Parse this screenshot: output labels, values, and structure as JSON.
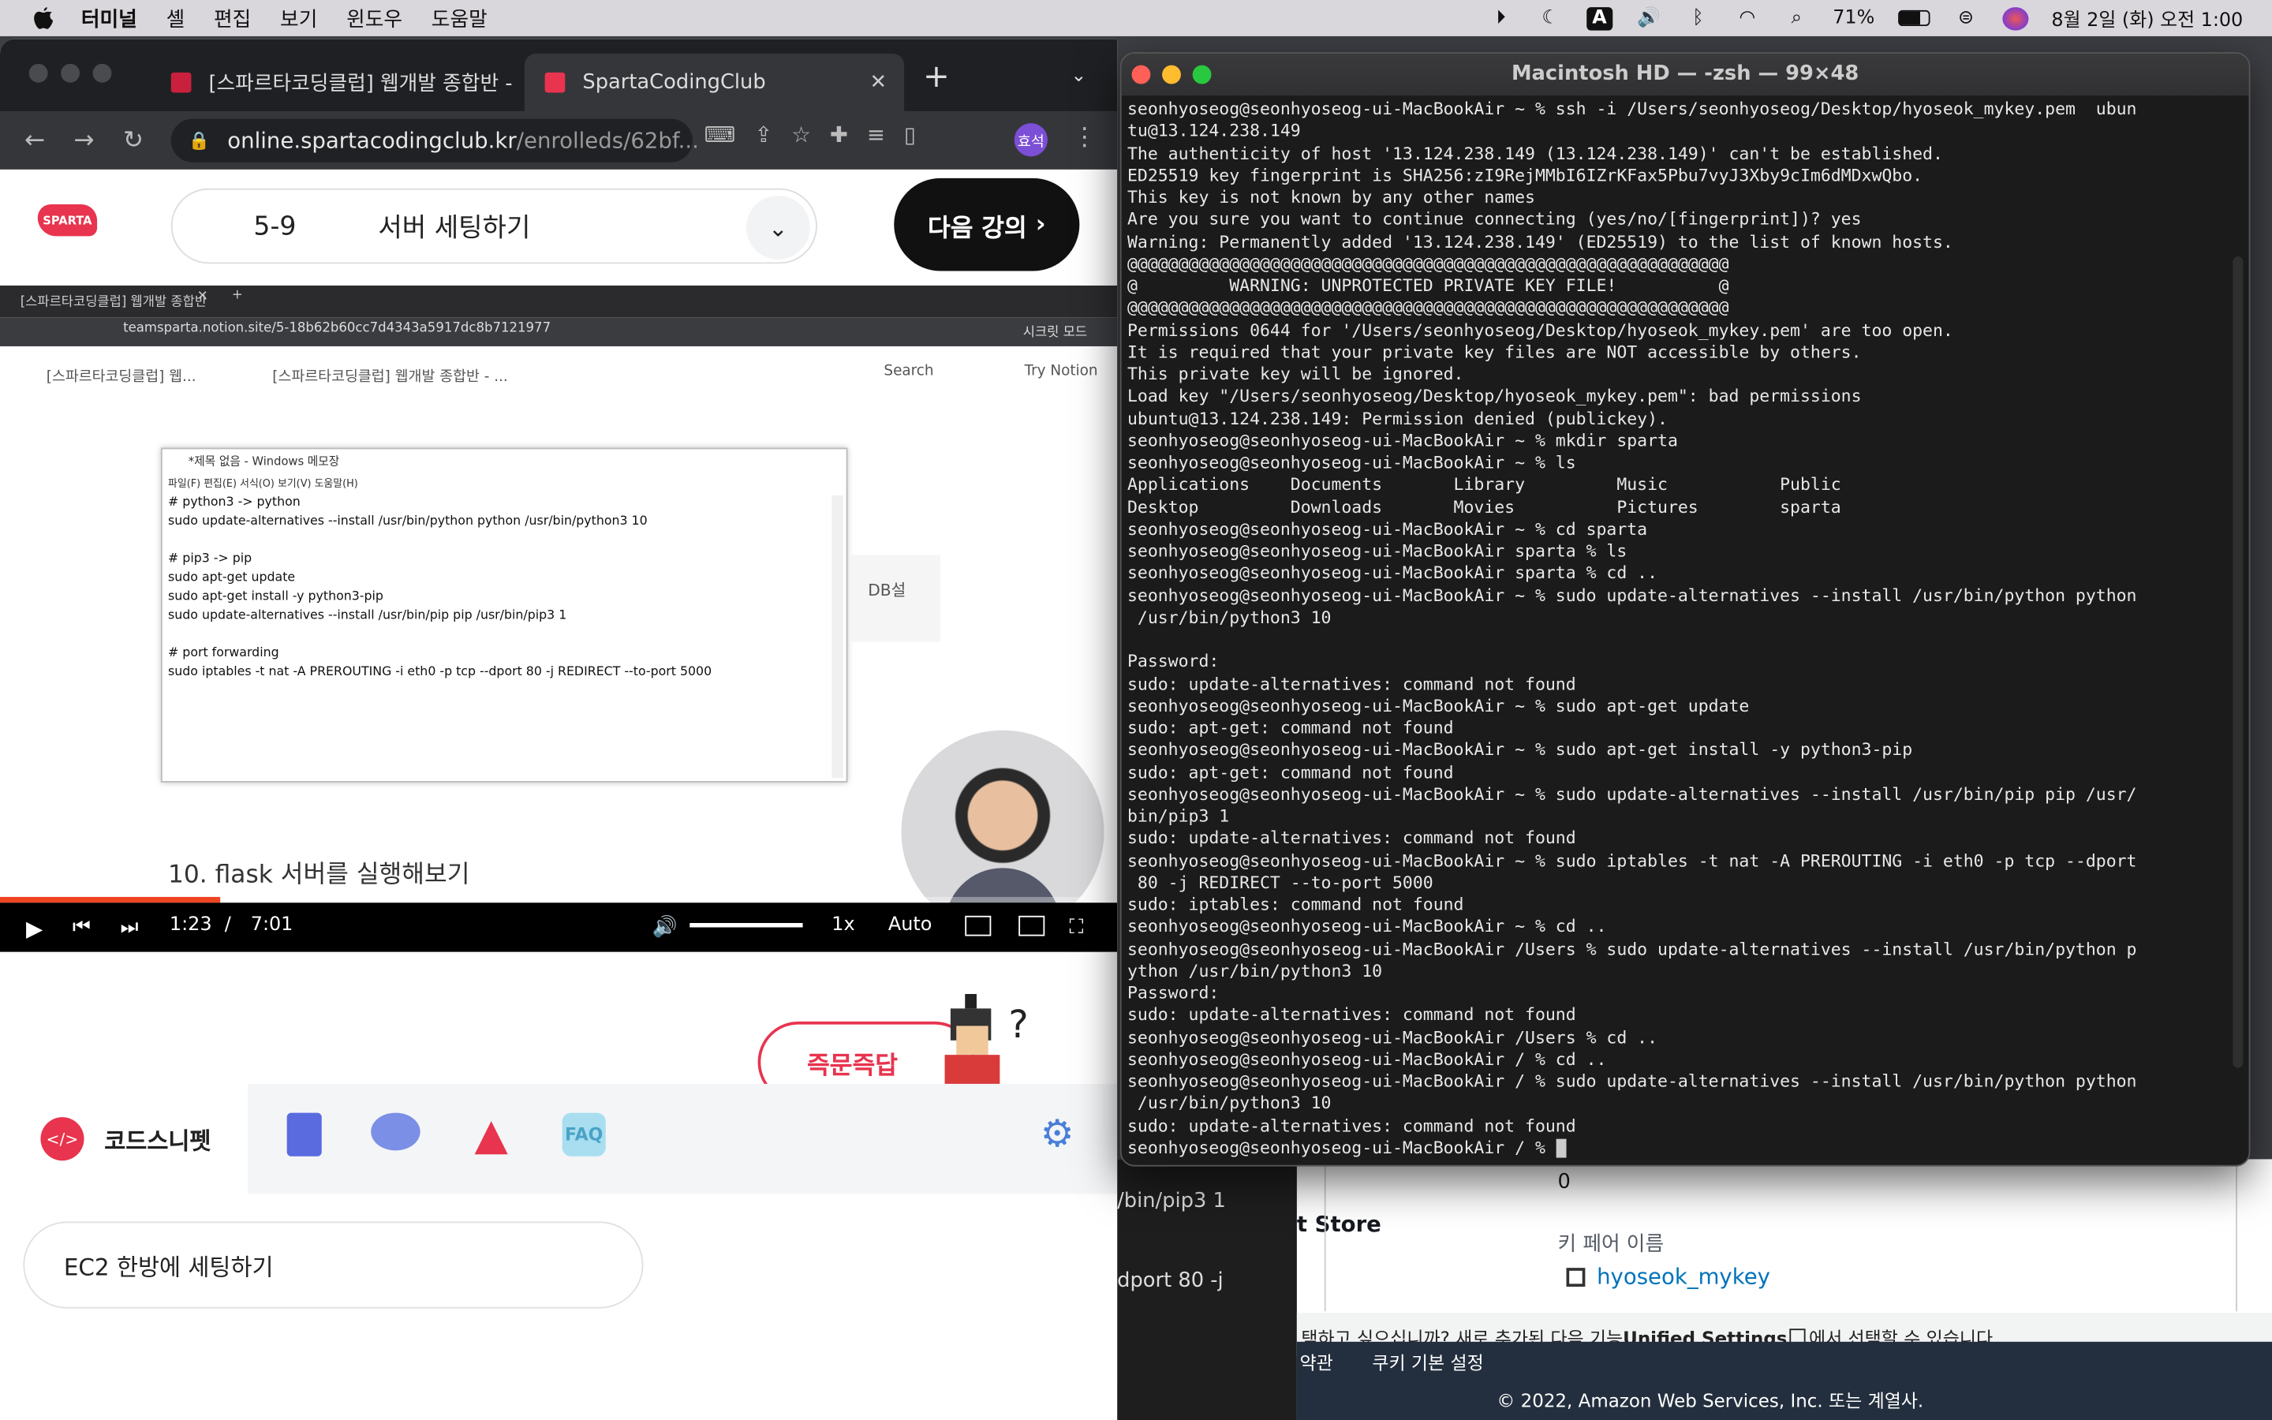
{
  "menubar": {
    "app": "터미널",
    "items": [
      "셸",
      "편집",
      "보기",
      "윈도우",
      "도움말"
    ],
    "battery": "71%",
    "datetime": "8월 2일 (화) 오전 1:00",
    "icons": [
      "apple-icon",
      "play-icon",
      "moon-icon",
      "input-icon",
      "volume-icon",
      "bluetooth-icon",
      "wifi-icon",
      "search-icon",
      "battery-icon",
      "control-center-icon",
      "siri-icon"
    ],
    "input_label": "A"
  },
  "browser": {
    "tabs": [
      {
        "title": "[스파르타코딩클럽] 웹개발 종합반 -",
        "favicon_color": "#c9213d"
      },
      {
        "title": "SpartaCodingClub",
        "favicon_color": "#e8344e"
      }
    ],
    "new_tab": "+",
    "url_host": "online.spartacodingclub.kr",
    "url_path": "/enrolleds/62bf...",
    "profile": "효석"
  },
  "lecture": {
    "logo": "SPARTA",
    "number": "5-9",
    "title": "서버 세팅하기",
    "next_label": "다음 강의"
  },
  "video": {
    "inner_tab": "[스파르타코딩클럽] 웹개발 종합반",
    "inner_url": "teamsparta.notion.site/5-18b62b60cc7d4343a5917dc8b7121977",
    "inner_profile": "시크릿 모드",
    "notion_breadcrumb": [
      "[스파르타코딩클럽] 웹...",
      "[스파르타코딩클럽] 웹개발 종합반 - ..."
    ],
    "notion_search": "Search",
    "notion_try": "Try Notion",
    "notepad_title": "*제목 없음 - Windows 메모장",
    "notepad_menu": "파일(F)  편집(E)  서식(O)  보기(V)  도움말(H)",
    "notepad_text": "# python3 -> python\nsudo update-alternatives --install /usr/bin/python python /usr/bin/python3 10\n\n# pip3 -> pip\nsudo apt-get update\nsudo apt-get install -y python3-pip\nsudo update-alternatives --install /usr/bin/pip pip /usr/bin/pip3 1\n\n# port forwarding\nsudo iptables -t nat -A PREROUTING -i eth0 -p tcp --dport 80 -j REDIRECT --to-port 5000",
    "db_label": "DB설",
    "section_heading": "10. flask 서버를 실행해보기",
    "current_time": "1:23",
    "sep": "/",
    "duration": "7:01",
    "played_fraction": 0.197,
    "speed": "1x",
    "quality": "Auto"
  },
  "qna_label": "즉문즉답",
  "bottom": {
    "active_tab": "코드스니펫",
    "faq": "FAQ",
    "snippet": "EC2 한방에 세팅하기"
  },
  "aws_bg": {
    "zero": "0",
    "keypair_label": "키 페어 이름",
    "keypair_value": "hyoseok_mykey",
    "store": "t Store",
    "pip_frag": "/bin/pip3 1",
    "dport_frag": "dport 80 -j",
    "notice_a": "택하고 싶으십니까? 새로 추가된 다음 기능",
    "notice_link": "Unified Settings",
    "notice_b": "에서 선택할 수 있습니다.",
    "link_terms": "약관",
    "link_cookie": "쿠키 기본 설정",
    "copyright": "© 2022, Amazon Web Services, Inc. 또는 계열사."
  },
  "terminal": {
    "title": "Macintosh HD — -zsh — 99×48",
    "lines": [
      "seonhyoseog@seonhyoseog-ui-MacBookAir ~ % ssh -i /Users/seonhyoseog/Desktop/hyoseok_mykey.pem  ubun",
      "tu@13.124.238.149",
      "The authenticity of host '13.124.238.149 (13.124.238.149)' can't be established.",
      "ED25519 key fingerprint is SHA256:zI9RejMMbI6IZrKFax5Pbu7vyJ3Xby9cIm6dMDxwQbo.",
      "This key is not known by any other names",
      "Are you sure you want to continue connecting (yes/no/[fingerprint])? yes",
      "Warning: Permanently added '13.124.238.149' (ED25519) to the list of known hosts.",
      "@@@@@@@@@@@@@@@@@@@@@@@@@@@@@@@@@@@@@@@@@@@@@@@@@@@@@@@@@@@",
      "@         WARNING: UNPROTECTED PRIVATE KEY FILE!          @",
      "@@@@@@@@@@@@@@@@@@@@@@@@@@@@@@@@@@@@@@@@@@@@@@@@@@@@@@@@@@@",
      "Permissions 0644 for '/Users/seonhyoseog/Desktop/hyoseok_mykey.pem' are too open.",
      "It is required that your private key files are NOT accessible by others.",
      "This private key will be ignored.",
      "Load key \"/Users/seonhyoseog/Desktop/hyoseok_mykey.pem\": bad permissions",
      "ubuntu@13.124.238.149: Permission denied (publickey).",
      "seonhyoseog@seonhyoseog-ui-MacBookAir ~ % mkdir sparta",
      "seonhyoseog@seonhyoseog-ui-MacBookAir ~ % ls",
      "Applications    Documents       Library         Music           Public",
      "Desktop         Downloads       Movies          Pictures        sparta",
      "seonhyoseog@seonhyoseog-ui-MacBookAir ~ % cd sparta",
      "seonhyoseog@seonhyoseog-ui-MacBookAir sparta % ls",
      "seonhyoseog@seonhyoseog-ui-MacBookAir sparta % cd ..",
      "seonhyoseog@seonhyoseog-ui-MacBookAir ~ % sudo update-alternatives --install /usr/bin/python python",
      " /usr/bin/python3 10",
      "",
      "Password:",
      "sudo: update-alternatives: command not found",
      "seonhyoseog@seonhyoseog-ui-MacBookAir ~ % sudo apt-get update",
      "sudo: apt-get: command not found",
      "seonhyoseog@seonhyoseog-ui-MacBookAir ~ % sudo apt-get install -y python3-pip",
      "sudo: apt-get: command not found",
      "seonhyoseog@seonhyoseog-ui-MacBookAir ~ % sudo update-alternatives --install /usr/bin/pip pip /usr/",
      "bin/pip3 1",
      "sudo: update-alternatives: command not found",
      "seonhyoseog@seonhyoseog-ui-MacBookAir ~ % sudo iptables -t nat -A PREROUTING -i eth0 -p tcp --dport",
      " 80 -j REDIRECT --to-port 5000",
      "sudo: iptables: command not found",
      "seonhyoseog@seonhyoseog-ui-MacBookAir ~ % cd ..",
      "seonhyoseog@seonhyoseog-ui-MacBookAir /Users % sudo update-alternatives --install /usr/bin/python p",
      "ython /usr/bin/python3 10",
      "Password:",
      "sudo: update-alternatives: command not found",
      "seonhyoseog@seonhyoseog-ui-MacBookAir /Users % cd ..",
      "seonhyoseog@seonhyoseog-ui-MacBookAir / % cd ..",
      "seonhyoseog@seonhyoseog-ui-MacBookAir / % sudo update-alternatives --install /usr/bin/python python",
      " /usr/bin/python3 10",
      "sudo: update-alternatives: command not found",
      "seonhyoseog@seonhyoseog-ui-MacBookAir / % "
    ]
  }
}
